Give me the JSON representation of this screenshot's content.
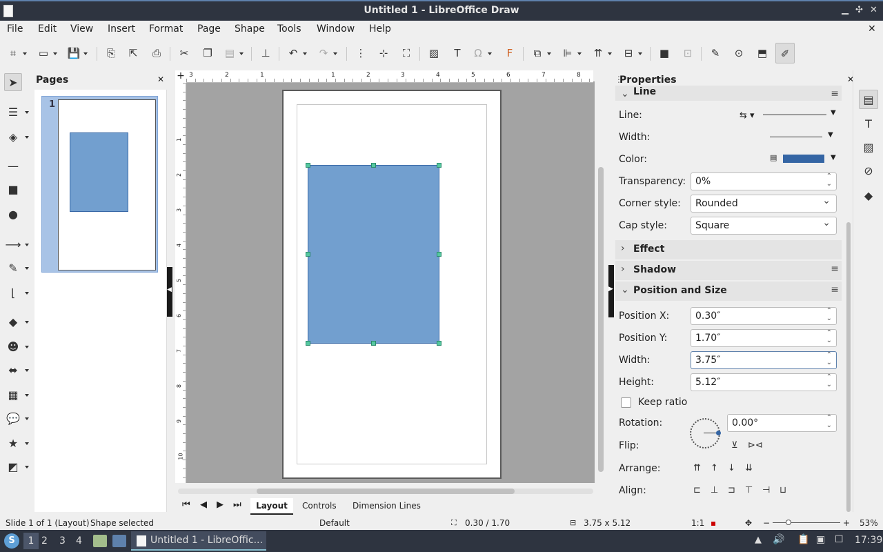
{
  "window": {
    "title": "Untitled 1 - LibreOffice Draw"
  },
  "menu": [
    "File",
    "Edit",
    "View",
    "Insert",
    "Format",
    "Page",
    "Shape",
    "Tools",
    "Window",
    "Help"
  ],
  "pages_panel": {
    "title": "Pages",
    "page_number": "1"
  },
  "properties": {
    "title": "Properties",
    "line_section": "Line",
    "line_label": "Line:",
    "width_label": "Width:",
    "color_label": "Color:",
    "line_color": "#3465a4",
    "transparency_label": "Transparency:",
    "transparency_value": "0%",
    "corner_label": "Corner style:",
    "corner_value": "Rounded",
    "cap_label": "Cap style:",
    "cap_value": "Square",
    "effect_section": "Effect",
    "shadow_section": "Shadow",
    "pos_section": "Position and Size",
    "posx_label": "Position X:",
    "posx_value": "0.30″",
    "posy_label": "Position Y:",
    "posy_value": "1.70″",
    "w_label": "Width:",
    "w_value": "3.75″",
    "h_label": "Height:",
    "h_value": "5.12″",
    "keep_ratio": "Keep ratio",
    "rotation_label": "Rotation:",
    "rotation_value": "0.00°",
    "flip_label": "Flip:",
    "arrange_label": "Arrange:",
    "align_label": "Align:"
  },
  "tabs": [
    "Layout",
    "Controls",
    "Dimension Lines"
  ],
  "status": {
    "slide": "Slide 1 of 1 (Layout)",
    "selection": "Shape selected",
    "style": "Default",
    "position": "0.30 / 1.70",
    "size": "3.75 x 5.12",
    "scale": "1:1",
    "zoom": "53%"
  },
  "taskbar": {
    "workspaces": [
      "1",
      "2",
      "3",
      "4"
    ],
    "task": "Untitled 1 - LibreOffic...",
    "clock": "17:39"
  },
  "ruler_h": [
    "3",
    "2",
    "1",
    "1",
    "2",
    "3",
    "4",
    "5",
    "6",
    "7",
    "8"
  ],
  "ruler_v": [
    "1",
    "2",
    "3",
    "4",
    "5",
    "6",
    "7",
    "8",
    "9",
    "10"
  ],
  "shape_color": "#729fcf"
}
